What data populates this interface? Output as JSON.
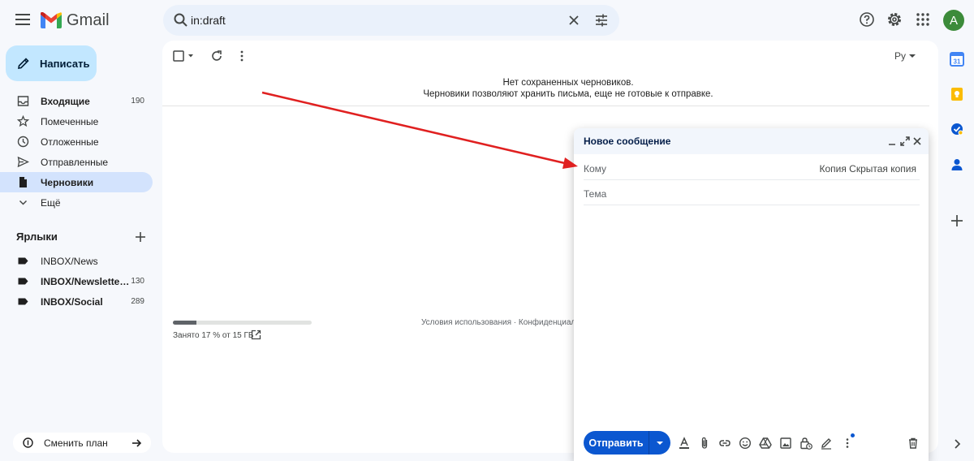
{
  "header": {
    "app_name": "Gmail",
    "menu_icon": "hamburger-icon",
    "search": {
      "value": "in:draft",
      "icon": "search-icon"
    },
    "icons": [
      "help-icon",
      "settings-icon",
      "apps-grid-icon"
    ],
    "avatar_letter": "A",
    "avatar_color": "#3c8b3a"
  },
  "compose_button": {
    "label": "Написать",
    "icon": "pencil-icon"
  },
  "sidebar": {
    "items": [
      {
        "label": "Входящие",
        "count": "190",
        "icon": "inbox-icon",
        "bold": true
      },
      {
        "label": "Помеченные",
        "count": "",
        "icon": "star-icon"
      },
      {
        "label": "Отложенные",
        "count": "",
        "icon": "clock-icon"
      },
      {
        "label": "Отправленные",
        "count": "",
        "icon": "send-icon"
      },
      {
        "label": "Черновики",
        "count": "",
        "icon": "draft-icon",
        "active": true
      },
      {
        "label": "Ещё",
        "count": "",
        "icon": "chevron-down-icon"
      }
    ],
    "labels_title": "Ярлыки",
    "labels": [
      {
        "label": "INBOX/News",
        "count": ""
      },
      {
        "label": "INBOX/Newslette…",
        "count": "130"
      },
      {
        "label": "INBOX/Social",
        "count": "289"
      }
    ],
    "plan_label": "Сменить план"
  },
  "main": {
    "language": "Ру",
    "empty_title": "Нет сохраненных черновиков.",
    "empty_subtitle": "Черновики позволяют хранить письма, еще не готовые к отправке.",
    "storage_text": "Занято 17 % от 15 ГБ",
    "storage_fraction": 0.17,
    "footer_links": "Условия использования · Конфиденциальн"
  },
  "compose_window": {
    "title": "Новое сообщение",
    "to_label": "Кому",
    "cc_bcc": "Копия Скрытая копия",
    "subject_placeholder": "Тема",
    "send_label": "Отправить",
    "toolbar_icons": [
      "format-text-icon",
      "attach-icon",
      "link-icon",
      "emoji-icon",
      "drive-icon",
      "image-icon",
      "lock-clock-icon",
      "signature-pen-icon",
      "more-vert-icon",
      "trash-icon"
    ]
  },
  "right_rail": {
    "icons": [
      "calendar-icon",
      "keep-icon",
      "tasks-icon",
      "contacts-icon",
      "add-icon",
      "chevron-right-icon"
    ]
  },
  "colors": {
    "accent": "#0b57d0",
    "compose_bg": "#c2e7ff",
    "active_nav": "#d3e3fd",
    "annotation_arrow": "#e02020"
  }
}
